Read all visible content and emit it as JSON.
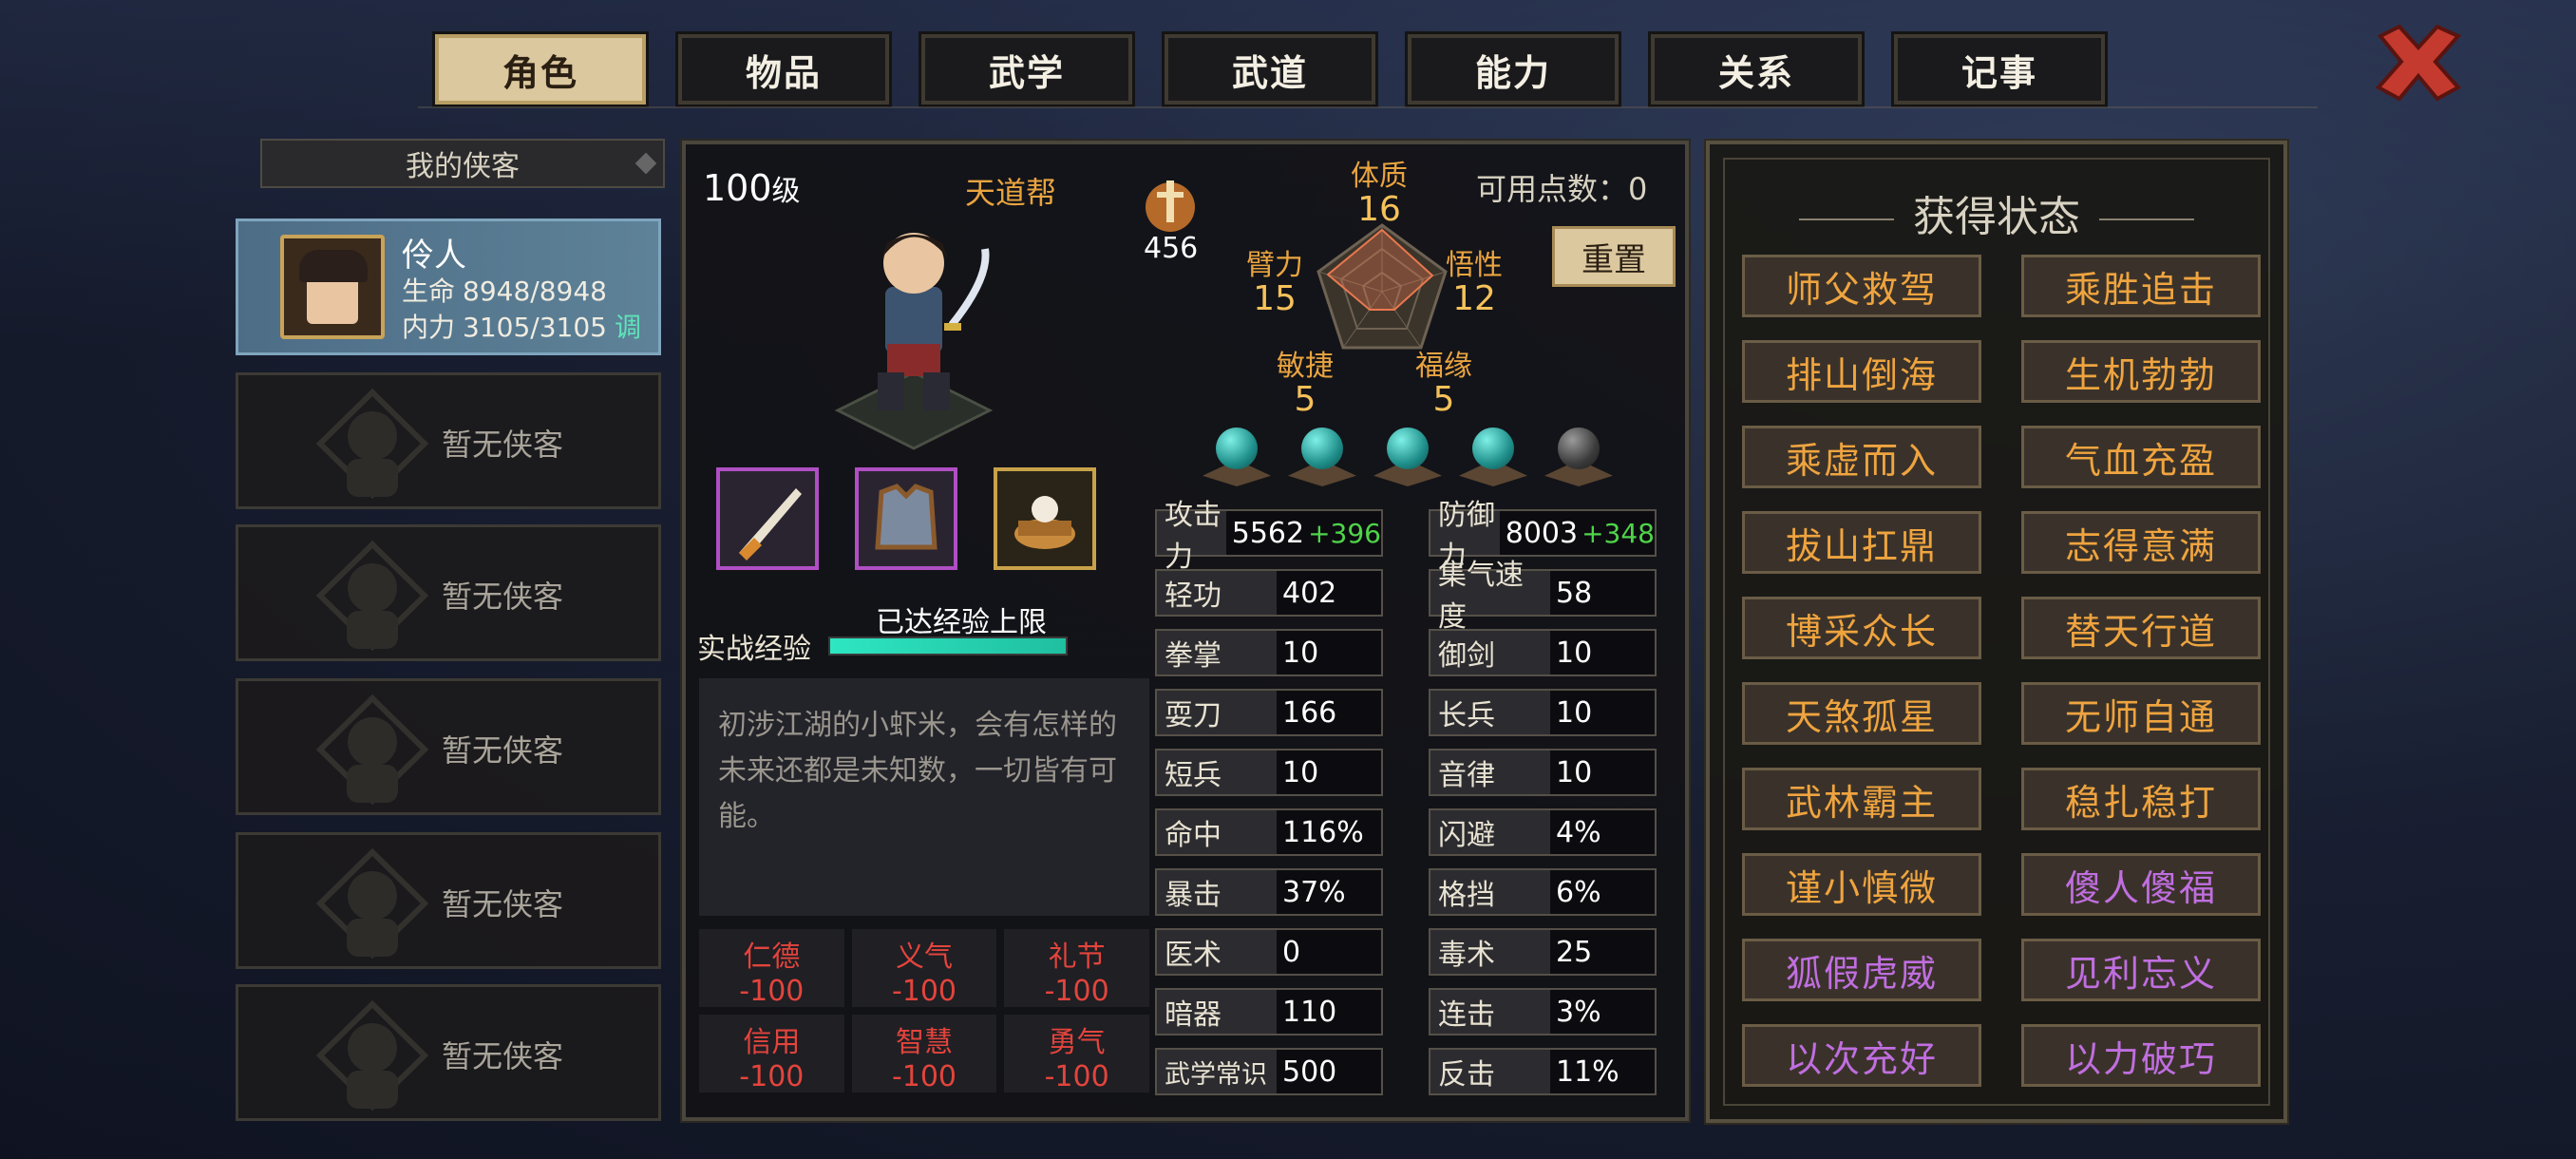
{
  "tabs": [
    {
      "label": "角色",
      "active": true
    },
    {
      "label": "物品",
      "active": false
    },
    {
      "label": "武学",
      "active": false
    },
    {
      "label": "武道",
      "active": false
    },
    {
      "label": "能力",
      "active": false
    },
    {
      "label": "关系",
      "active": false
    },
    {
      "label": "记事",
      "active": false
    }
  ],
  "roster": {
    "title": "我的侠客",
    "selected": {
      "name": "伶人",
      "hp_label": "生命",
      "hp": "8948/8948",
      "mp_label": "内力",
      "mp": "3105/3105",
      "adjust": "调"
    },
    "empty_label": "暂无侠客"
  },
  "character": {
    "level": "100",
    "level_unit": "级",
    "sect": "天道帮",
    "power": "456",
    "available_points_label": "可用点数：",
    "available_points": "0",
    "reset_label": "重置",
    "radar": [
      {
        "label": "体质",
        "value": "16"
      },
      {
        "label": "臂力",
        "value": "15"
      },
      {
        "label": "悟性",
        "value": "12"
      },
      {
        "label": "敏捷",
        "value": "5"
      },
      {
        "label": "福缘",
        "value": "5"
      }
    ],
    "orbs": [
      "teal",
      "teal",
      "teal",
      "teal",
      "dark"
    ],
    "exp_label": "实战经验",
    "exp_cap": "已达经验上限",
    "exp_progress": 1.0,
    "description": "初涉江湖的小虾米，会有怎样的未来还都是未知数，一切皆有可能。",
    "morals": [
      {
        "k": "仁德",
        "v": "-100"
      },
      {
        "k": "义气",
        "v": "-100"
      },
      {
        "k": "礼节",
        "v": "-100"
      },
      {
        "k": "信用",
        "v": "-100"
      },
      {
        "k": "智慧",
        "v": "-100"
      },
      {
        "k": "勇气",
        "v": "-100"
      }
    ],
    "stats": [
      {
        "k": "攻击力",
        "v": "5562",
        "bonus": "+396"
      },
      {
        "k": "防御力",
        "v": "8003",
        "bonus": "+348"
      },
      {
        "k": "轻功",
        "v": "402"
      },
      {
        "k": "集气速度",
        "v": "58"
      },
      {
        "k": "拳掌",
        "v": "10"
      },
      {
        "k": "御剑",
        "v": "10"
      },
      {
        "k": "耍刀",
        "v": "166"
      },
      {
        "k": "长兵",
        "v": "10"
      },
      {
        "k": "短兵",
        "v": "10"
      },
      {
        "k": "音律",
        "v": "10"
      },
      {
        "k": "命中",
        "v": "116%"
      },
      {
        "k": "闪避",
        "v": "4%"
      },
      {
        "k": "暴击",
        "v": "37%"
      },
      {
        "k": "格挡",
        "v": "6%"
      },
      {
        "k": "医术",
        "v": "0"
      },
      {
        "k": "毒术",
        "v": "25"
      },
      {
        "k": "暗器",
        "v": "110"
      },
      {
        "k": "连击",
        "v": "3%"
      },
      {
        "k": "武学常识",
        "v": "500"
      },
      {
        "k": "反击",
        "v": "11%"
      }
    ]
  },
  "buffs_panel": {
    "title": "获得状态",
    "items": [
      {
        "label": "师父救驾",
        "color": "orange"
      },
      {
        "label": "乘胜追击",
        "color": "orange"
      },
      {
        "label": "排山倒海",
        "color": "orange"
      },
      {
        "label": "生机勃勃",
        "color": "orange"
      },
      {
        "label": "乘虚而入",
        "color": "orange"
      },
      {
        "label": "气血充盈",
        "color": "orange"
      },
      {
        "label": "拔山扛鼎",
        "color": "orange"
      },
      {
        "label": "志得意满",
        "color": "orange"
      },
      {
        "label": "博采众长",
        "color": "orange"
      },
      {
        "label": "替天行道",
        "color": "orange"
      },
      {
        "label": "天煞孤星",
        "color": "orange"
      },
      {
        "label": "无师自通",
        "color": "orange"
      },
      {
        "label": "武林霸主",
        "color": "orange"
      },
      {
        "label": "稳扎稳打",
        "color": "orange"
      },
      {
        "label": "谨小慎微",
        "color": "orange"
      },
      {
        "label": "傻人傻福",
        "color": "purple"
      },
      {
        "label": "狐假虎威",
        "color": "purple"
      },
      {
        "label": "见利忘义",
        "color": "purple"
      },
      {
        "label": "以次充好",
        "color": "purple"
      },
      {
        "label": "以力破巧",
        "color": "purple"
      }
    ]
  }
}
